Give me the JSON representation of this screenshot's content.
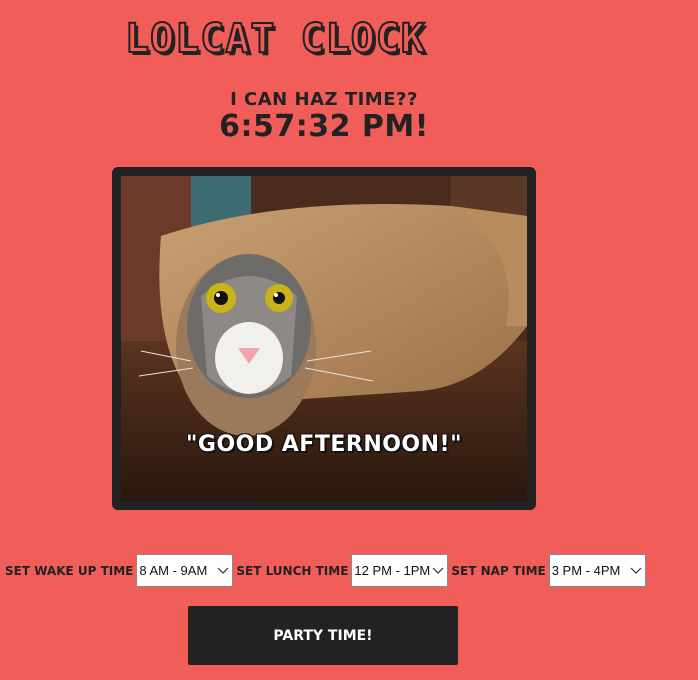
{
  "title": "LOLCAT CLOCK",
  "clock": {
    "caption": "I CAN HAZ TIME??",
    "time": "6:57:32 PM!"
  },
  "photo": {
    "greeting": "\"GOOD AFTERNOON!\""
  },
  "controls": {
    "wake": {
      "label": "SET WAKE UP TIME",
      "selected": "8 AM - 9AM"
    },
    "lunch": {
      "label": "SET LUNCH TIME",
      "selected": "12 PM - 1PM"
    },
    "nap": {
      "label": "SET NAP TIME",
      "selected": "3 PM - 4PM"
    }
  },
  "party_button": "PARTY TIME!",
  "colors": {
    "background": "#f15e59",
    "dark": "#222222"
  }
}
